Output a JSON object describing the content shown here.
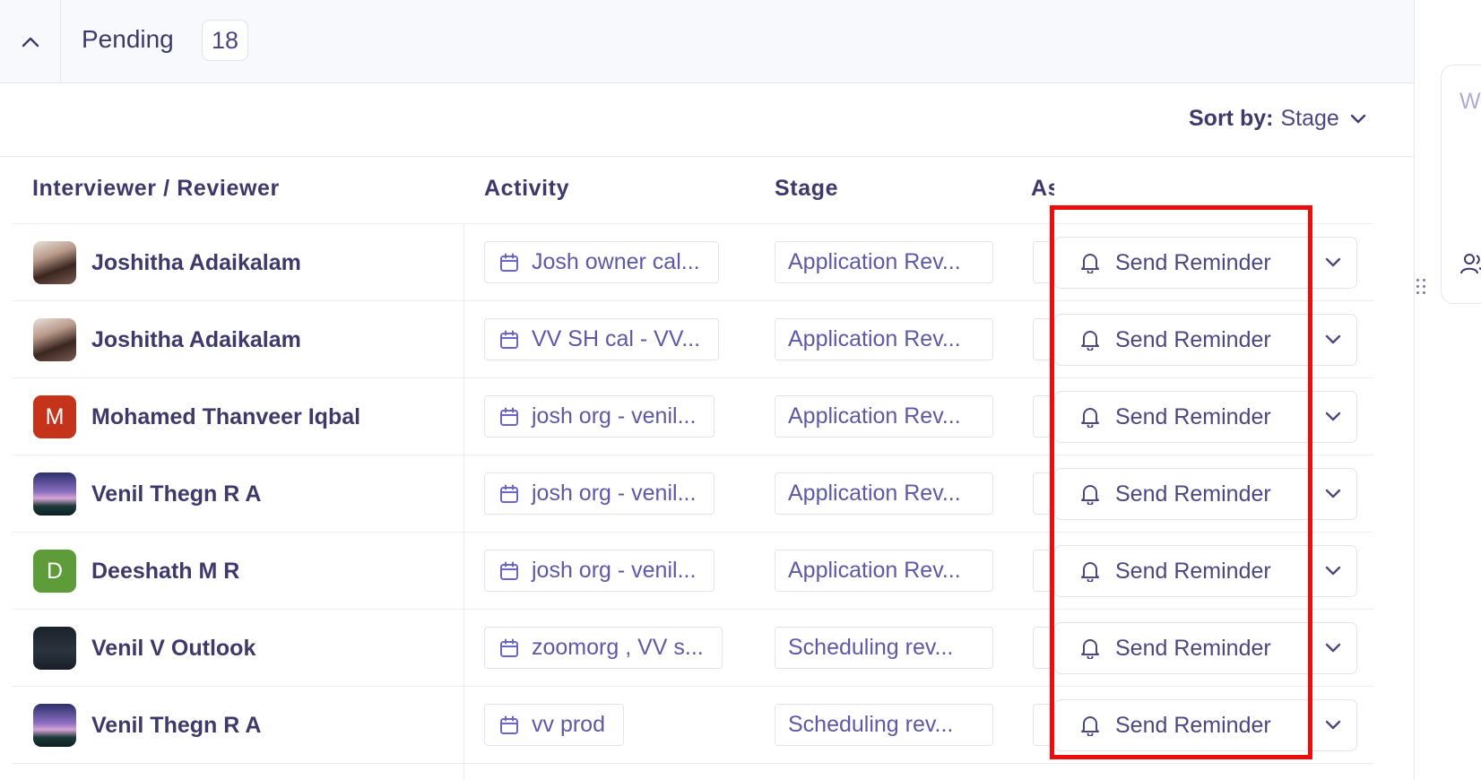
{
  "header": {
    "title": "Pending",
    "count": "18"
  },
  "sort": {
    "label": "Sort by:",
    "value": "Stage"
  },
  "columns": {
    "reviewer": "Interviewer / Reviewer",
    "activity": "Activity",
    "stage": "Stage",
    "assignee": "As"
  },
  "rows": [
    {
      "name": "Joshitha Adaikalam",
      "activity": "Josh owner cal...",
      "stage": "Application Rev...",
      "reminder": "Send Reminder"
    },
    {
      "name": "Joshitha Adaikalam",
      "activity": "VV SH cal - VV...",
      "stage": "Application Rev...",
      "reminder": "Send Reminder"
    },
    {
      "name": "Mohamed Thanveer Iqbal",
      "initial": "M",
      "activity": "josh org - venil...",
      "stage": "Application Rev...",
      "reminder": "Send Reminder"
    },
    {
      "name": "Venil Thegn R A",
      "activity": "josh org - venil...",
      "stage": "Application Rev...",
      "reminder": "Send Reminder"
    },
    {
      "name": "Deeshath M R",
      "initial": "D",
      "activity": "josh org - venil...",
      "stage": "Application Rev...",
      "reminder": "Send Reminder"
    },
    {
      "name": "Venil V Outlook",
      "activity": "zoomorg , VV s...",
      "stage": "Scheduling rev...",
      "reminder": "Send Reminder"
    },
    {
      "name": "Venil Thegn R A",
      "activity": "vv prod",
      "stage": "Scheduling rev...",
      "reminder": "Send Reminder"
    }
  ],
  "side_panel": {
    "card_letter": "W"
  },
  "colors": {
    "text_primary": "#3d3a6b",
    "text_accent": "#5d59a6",
    "highlight": "#ee0d0d",
    "avatar_red": "#c6331b",
    "avatar_green": "#5e9c39"
  },
  "icons": {
    "collapse": "chevron-up-icon",
    "sort": "chevron-down-icon",
    "activity": "calendar-icon",
    "reminder": "bell-icon",
    "more": "chevron-down-icon",
    "side": "users-icon"
  }
}
